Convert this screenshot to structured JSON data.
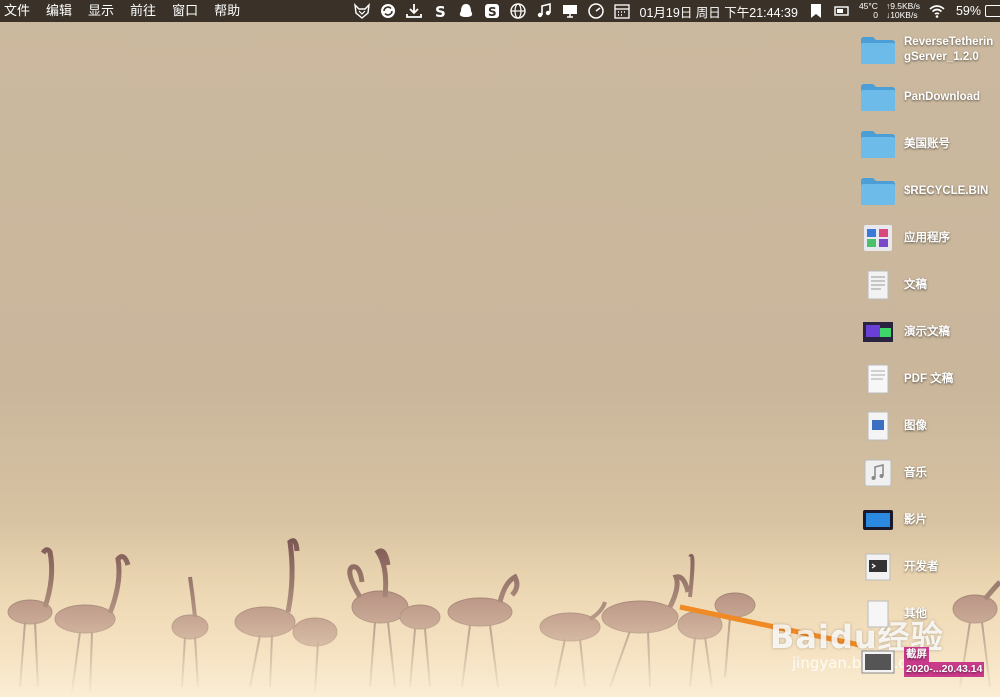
{
  "menubar": {
    "items": [
      "文件",
      "编辑",
      "显示",
      "前往",
      "窗口",
      "帮助"
    ],
    "clock": "01月19日 周日 下午21:44:39",
    "temp_top": "45°C",
    "temp_bottom": "0",
    "net_up": "↑9.5KB/s",
    "net_down": "↓10KB/s",
    "battery": "59%"
  },
  "status_icons": [
    "fox-icon",
    "globe-sync-icon",
    "download-icon",
    "s-icon",
    "qq-icon",
    "sogou-s-icon",
    "network-globe-icon",
    "music-note-icon",
    "display-icon",
    "speed-icon",
    "calendar-icon",
    "bookmark-icon",
    "battery-mini-icon",
    "wifi-icon"
  ],
  "desktop_items": [
    {
      "label": "ReverseTetheringServer_1.2.0",
      "icon": "folder-icon"
    },
    {
      "label": "PanDownload",
      "icon": "folder-icon"
    },
    {
      "label": "美国账号",
      "icon": "folder-icon"
    },
    {
      "label": "$RECYCLE.BIN",
      "icon": "folder-icon"
    },
    {
      "label": "应用程序",
      "icon": "applications-stack-icon"
    },
    {
      "label": "文稿",
      "icon": "documents-stack-icon"
    },
    {
      "label": "演示文稿",
      "icon": "presentation-stack-icon"
    },
    {
      "label": "PDF 文稿",
      "icon": "pdf-stack-icon"
    },
    {
      "label": "图像",
      "icon": "images-stack-icon"
    },
    {
      "label": "音乐",
      "icon": "music-stack-icon"
    },
    {
      "label": "影片",
      "icon": "movies-stack-icon"
    },
    {
      "label": "开发者",
      "icon": "developer-stack-icon"
    },
    {
      "label": "其他",
      "icon": "other-stack-icon"
    },
    {
      "label": "截屏",
      "icon": "screenshot-stack-icon"
    }
  ],
  "screenshot_file": "2020-...20.43.14",
  "watermark": {
    "main": "Baidu经验",
    "sub": "jingyan.baidu.com"
  },
  "colors": {
    "menubar": "#3a3228",
    "folder": "#5aa9dc",
    "selection": "#c93a8a"
  }
}
